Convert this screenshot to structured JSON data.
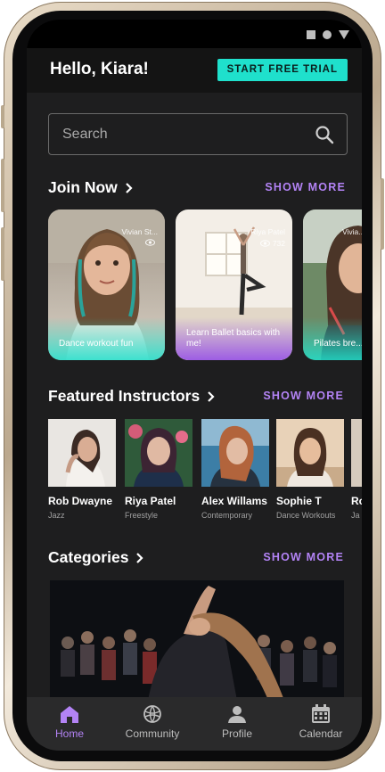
{
  "header": {
    "greeting": "Hello, Kiara!",
    "trial_button": "START FREE TRIAL"
  },
  "search": {
    "placeholder": "Search"
  },
  "join_now": {
    "title": "Join Now",
    "show_more": "SHOW MORE",
    "cards": [
      {
        "title": "Dance workout fun",
        "host": "Vivian St...",
        "views": ""
      },
      {
        "title": "Learn Ballet basics with me!",
        "host": "Riya Patel",
        "views": "732"
      },
      {
        "title": "Pilates bre...",
        "host": "Vivia...",
        "views": ""
      }
    ]
  },
  "featured": {
    "title": "Featured Instructors",
    "show_more": "SHOW MORE",
    "instructors": [
      {
        "name": "Rob Dwayne",
        "style": "Jazz"
      },
      {
        "name": "Riya Patel",
        "style": "Freestyle"
      },
      {
        "name": "Alex Willams",
        "style": "Contemporary"
      },
      {
        "name": "Sophie T",
        "style": "Dance Workouts"
      },
      {
        "name": "Ro",
        "style": "Ja"
      }
    ]
  },
  "categories": {
    "title": "Categories",
    "show_more": "SHOW MORE"
  },
  "nav": {
    "items": [
      {
        "label": "Home",
        "icon": "home-icon",
        "active": true
      },
      {
        "label": "Community",
        "icon": "globe-icon",
        "active": false
      },
      {
        "label": "Profile",
        "icon": "person-icon",
        "active": false
      },
      {
        "label": "Calendar",
        "icon": "calendar-icon",
        "active": false
      }
    ]
  },
  "colors": {
    "accent_teal": "#1fe0cc",
    "accent_purple": "#b383f5",
    "background": "#1e1e1f"
  }
}
